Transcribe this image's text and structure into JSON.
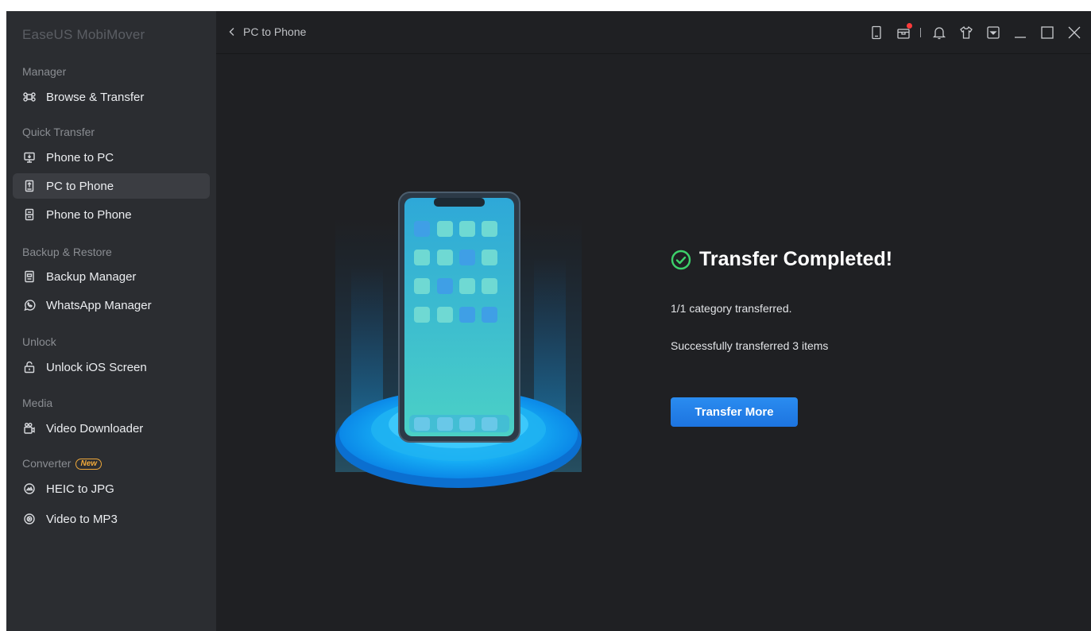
{
  "app": {
    "title": "EaseUS MobiMover"
  },
  "sidebar": {
    "sections": [
      {
        "label": "Manager",
        "items": [
          {
            "label": "Browse & Transfer",
            "icon": "command-icon"
          }
        ]
      },
      {
        "label": "Quick Transfer",
        "items": [
          {
            "label": "Phone to PC",
            "icon": "phone-to-pc-icon"
          },
          {
            "label": "PC to Phone",
            "icon": "pc-to-phone-icon",
            "active": true
          },
          {
            "label": "Phone to Phone",
            "icon": "phone-to-phone-icon"
          }
        ]
      },
      {
        "label": "Backup & Restore",
        "items": [
          {
            "label": "Backup Manager",
            "icon": "backup-icon"
          },
          {
            "label": "WhatsApp Manager",
            "icon": "whatsapp-icon"
          }
        ]
      },
      {
        "label": "Unlock",
        "items": [
          {
            "label": "Unlock iOS Screen",
            "icon": "lock-icon"
          }
        ]
      },
      {
        "label": "Media",
        "items": [
          {
            "label": "Video Downloader",
            "icon": "video-downloader-icon"
          }
        ]
      },
      {
        "label": "Converter",
        "badge": "New",
        "items": [
          {
            "label": "HEIC to JPG",
            "icon": "heic-convert-icon"
          },
          {
            "label": "Video to MP3",
            "icon": "video-to-mp3-icon"
          }
        ]
      }
    ]
  },
  "header": {
    "breadcrumb": "PC to Phone"
  },
  "topbar_icons": [
    "device-icon",
    "gift-icon",
    "bell-icon",
    "shirt-icon",
    "menu-dropdown-icon",
    "minimize-icon",
    "maximize-icon",
    "close-icon"
  ],
  "result": {
    "title": "Transfer Completed!",
    "category_line": "1/1 category transferred.",
    "items_line": "Successfully transferred 3 items",
    "button": "Transfer More"
  },
  "colors": {
    "accent": "#1d7fe6",
    "success": "#3dd26b",
    "sidebar_bg": "#2b2d31",
    "main_bg": "#1f2023",
    "notification": "#ff3b3b"
  }
}
